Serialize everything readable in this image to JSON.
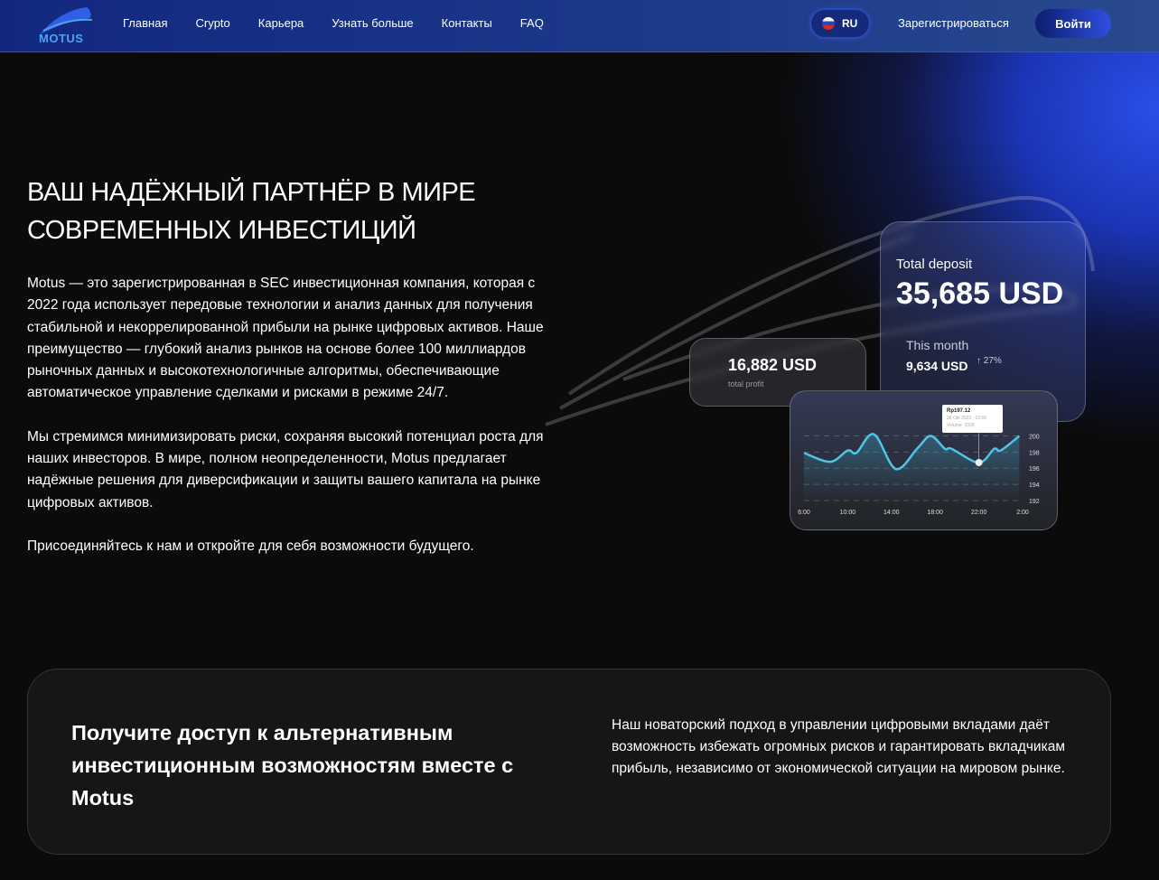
{
  "header": {
    "logo": "MOTUS",
    "nav": [
      "Главная",
      "Crypto",
      "Карьера",
      "Узнать больше",
      "Контакты",
      "FAQ"
    ],
    "lang": "RU",
    "register": "Зарегистрироваться",
    "login": "Войти"
  },
  "hero": {
    "title": "ВАШ НАДЁЖНЫЙ ПАРТНЁР В МИРЕ СОВРЕМЕННЫХ ИНВЕСТИЦИЙ",
    "paragraphs": [
      "Motus — это зарегистрированная в SEC инвестиционная компания, которая с 2022 года использует передовые технологии и анализ данных для получения стабильной и некоррелированной прибыли на рынке цифровых активов. Наше преимущество — глубокий анализ рынков на основе более 100 миллиардов рыночных данных и высокотехнологичные алгоритмы, обеспечивающие автоматическое управление сделками и рисками в режиме 24/7.",
      "Мы стремимся минимизировать риски, сохраняя высокий потенциал роста для наших инвесторов. В мире, полном неопределенности, Motus предлагает надёжные решения для диверсификации и защиты вашего капитала на рынке цифровых активов.",
      "Присоединяйтесь к нам и откройте для себя возможности будущего."
    ]
  },
  "deposit": {
    "label": "Total deposit",
    "value": "35,685 USD",
    "month_label": "This month",
    "month_value": "9,634 USD",
    "change": "↑ 27%"
  },
  "profit": {
    "value": "16,882 USD",
    "label": "total profit"
  },
  "chart_data": {
    "type": "line",
    "x_ticks": [
      "6:00",
      "10:00",
      "14:00",
      "18:00",
      "22:00",
      "2:00"
    ],
    "y_ticks": [
      "200",
      "198",
      "196",
      "194",
      "192"
    ],
    "ylim": [
      192,
      200.5
    ],
    "x": [
      6,
      8.4,
      10,
      10.8,
      12.4,
      14.4,
      16.4,
      17.6,
      18.9,
      19.5,
      22,
      23.4,
      24,
      25.7
    ],
    "y": [
      197.9,
      196.8,
      198.2,
      197.9,
      200.2,
      195.9,
      198.5,
      200,
      198.4,
      198.4,
      196.7,
      198.4,
      198.2,
      200
    ],
    "tooltip": {
      "price": "Rp197.12",
      "date": "28 Okt 2023 - 22:00",
      "volume": "Volume: 102K",
      "x": 22
    },
    "line_color": "#4cc6e4"
  },
  "bottom": {
    "title": "Получите доступ к альтернативным инвестиционным возможностям вместе с Motus",
    "text": "Наш новаторский подход в управлении цифровыми вкладами даёт возможность избежать огромных рисков и гарантировать вкладчикам прибыль, независимо от экономической ситуации на мировом рынке."
  }
}
